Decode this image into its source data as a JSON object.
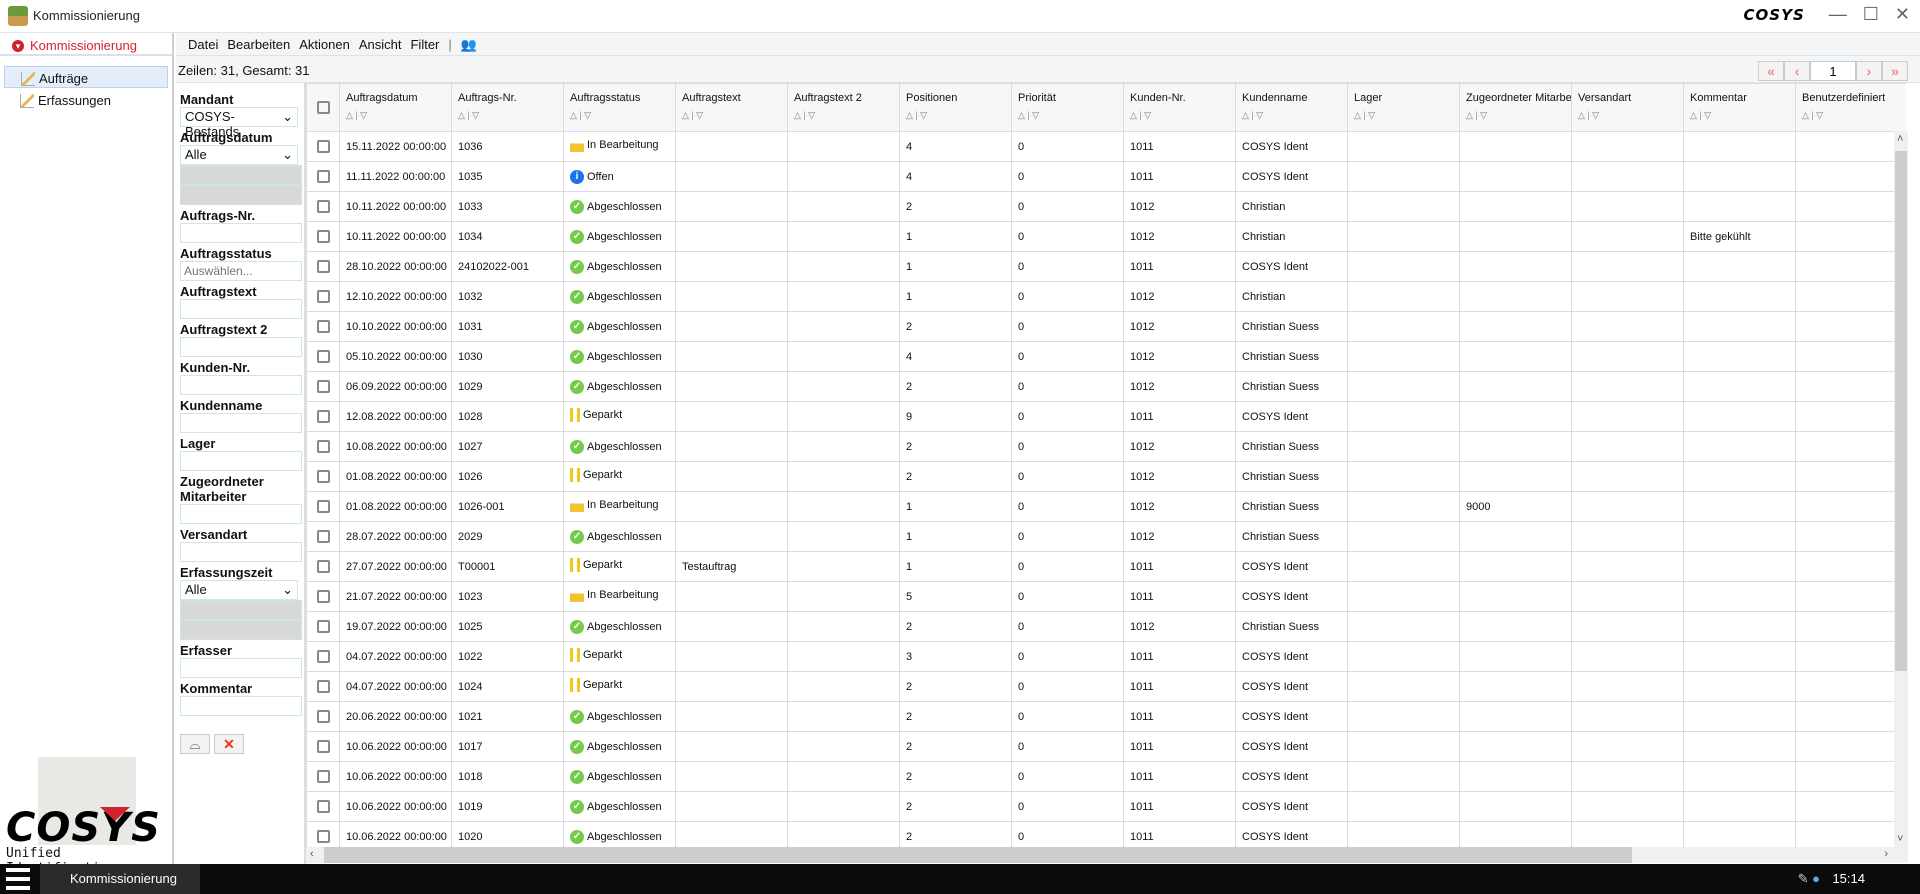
{
  "window": {
    "title": "Kommissionierung",
    "brand": "COSYS",
    "minimize": "—",
    "maximize": "☐",
    "close": "✕"
  },
  "sidebar": {
    "module": "Kommissionierung",
    "items": [
      {
        "label": "Aufträge",
        "selected": true
      },
      {
        "label": "Erfassungen",
        "selected": false
      }
    ],
    "logo_word": "COSYS",
    "logo_sub": "Unified Identification"
  },
  "toolbar": {
    "menus": [
      "Datei",
      "Bearbeiten",
      "Aktionen",
      "Ansicht",
      "Filter"
    ],
    "separator": "|"
  },
  "count": "Zeilen: 31, Gesamt: 31",
  "pager": {
    "page": "1",
    "first": "«",
    "prev": "‹",
    "next": "›",
    "last": "»"
  },
  "filter": {
    "mandant_label": "Mandant",
    "mandant_value": "COSYS-Bestands",
    "auftragsdatum_label": "Auftragsdatum",
    "auftragsdatum_value": "Alle",
    "auftragsnr_label": "Auftrags-Nr.",
    "auftragsstatus_label": "Auftragsstatus",
    "auftragsstatus_placeholder": "Auswählen...",
    "auftragstext_label": "Auftragstext",
    "auftragstext2_label": "Auftragstext 2",
    "kundennr_label": "Kunden-Nr.",
    "kundenname_label": "Kundenname",
    "lager_label": "Lager",
    "mitarbeiter_label1": "Zugeordneter",
    "mitarbeiter_label2": "Mitarbeiter",
    "versandart_label": "Versandart",
    "erfassungszeit_label": "Erfassungszeit",
    "erfassungszeit_value": "Alle",
    "erfasser_label": "Erfasser",
    "kommentar_label": "Kommentar"
  },
  "columns": [
    "Auftragsdatum",
    "Auftrags-Nr.",
    "Auftragsstatus",
    "Auftragstext",
    "Auftragstext 2",
    "Positionen",
    "Priorität",
    "Kunden-Nr.",
    "Kundenname",
    "Lager",
    "Zugeordneter Mitarbeiter",
    "Versandart",
    "Kommentar",
    "Benutzerdefiniert"
  ],
  "status_colors": {
    "Abgeschlossen": "#74cb4a",
    "Offen": "#1a73e8",
    "Geparkt": "#f4c71a",
    "In Bearbeitung": "#f2c230"
  },
  "rows": [
    [
      "15.11.2022 00:00:00",
      "1036",
      "In Bearbeitung",
      "",
      "",
      "4",
      "0",
      "1011",
      "COSYS Ident",
      "",
      "",
      "",
      "",
      ""
    ],
    [
      "11.11.2022 00:00:00",
      "1035",
      "Offen",
      "",
      "",
      "4",
      "0",
      "1011",
      "COSYS Ident",
      "",
      "",
      "",
      "",
      ""
    ],
    [
      "10.11.2022 00:00:00",
      "1033",
      "Abgeschlossen",
      "",
      "",
      "2",
      "0",
      "1012",
      "Christian",
      "",
      "",
      "",
      "",
      ""
    ],
    [
      "10.11.2022 00:00:00",
      "1034",
      "Abgeschlossen",
      "",
      "",
      "1",
      "0",
      "1012",
      "Christian",
      "",
      "",
      "",
      "Bitte gekühlt",
      ""
    ],
    [
      "28.10.2022 00:00:00",
      "24102022-001",
      "Abgeschlossen",
      "",
      "",
      "1",
      "0",
      "1011",
      "COSYS Ident",
      "",
      "",
      "",
      "",
      ""
    ],
    [
      "12.10.2022 00:00:00",
      "1032",
      "Abgeschlossen",
      "",
      "",
      "1",
      "0",
      "1012",
      "Christian",
      "",
      "",
      "",
      "",
      ""
    ],
    [
      "10.10.2022 00:00:00",
      "1031",
      "Abgeschlossen",
      "",
      "",
      "2",
      "0",
      "1012",
      "Christian Suess",
      "",
      "",
      "",
      "",
      ""
    ],
    [
      "05.10.2022 00:00:00",
      "1030",
      "Abgeschlossen",
      "",
      "",
      "4",
      "0",
      "1012",
      "Christian Suess",
      "",
      "",
      "",
      "",
      ""
    ],
    [
      "06.09.2022 00:00:00",
      "1029",
      "Abgeschlossen",
      "",
      "",
      "2",
      "0",
      "1012",
      "Christian Suess",
      "",
      "",
      "",
      "",
      ""
    ],
    [
      "12.08.2022 00:00:00",
      "1028",
      "Geparkt",
      "",
      "",
      "9",
      "0",
      "1011",
      "COSYS Ident",
      "",
      "",
      "",
      "",
      ""
    ],
    [
      "10.08.2022 00:00:00",
      "1027",
      "Abgeschlossen",
      "",
      "",
      "2",
      "0",
      "1012",
      "Christian Suess",
      "",
      "",
      "",
      "",
      ""
    ],
    [
      "01.08.2022 00:00:00",
      "1026",
      "Geparkt",
      "",
      "",
      "2",
      "0",
      "1012",
      "Christian Suess",
      "",
      "",
      "",
      "",
      ""
    ],
    [
      "01.08.2022 00:00:00",
      "1026-001",
      "In Bearbeitung",
      "",
      "",
      "1",
      "0",
      "1012",
      "Christian Suess",
      "",
      "9000",
      "",
      "",
      ""
    ],
    [
      "28.07.2022 00:00:00",
      "2029",
      "Abgeschlossen",
      "",
      "",
      "1",
      "0",
      "1012",
      "Christian Suess",
      "",
      "",
      "",
      "",
      ""
    ],
    [
      "27.07.2022 00:00:00",
      "T00001",
      "Geparkt",
      "Testauftrag",
      "",
      "1",
      "0",
      "1011",
      "COSYS Ident",
      "",
      "",
      "",
      "",
      ""
    ],
    [
      "21.07.2022 00:00:00",
      "1023",
      "In Bearbeitung",
      "",
      "",
      "5",
      "0",
      "1011",
      "COSYS Ident",
      "",
      "",
      "",
      "",
      ""
    ],
    [
      "19.07.2022 00:00:00",
      "1025",
      "Abgeschlossen",
      "",
      "",
      "2",
      "0",
      "1012",
      "Christian Suess",
      "",
      "",
      "",
      "",
      ""
    ],
    [
      "04.07.2022 00:00:00",
      "1022",
      "Geparkt",
      "",
      "",
      "3",
      "0",
      "1011",
      "COSYS Ident",
      "",
      "",
      "",
      "",
      ""
    ],
    [
      "04.07.2022 00:00:00",
      "1024",
      "Geparkt",
      "",
      "",
      "2",
      "0",
      "1011",
      "COSYS Ident",
      "",
      "",
      "",
      "",
      ""
    ],
    [
      "20.06.2022 00:00:00",
      "1021",
      "Abgeschlossen",
      "",
      "",
      "2",
      "0",
      "1011",
      "COSYS Ident",
      "",
      "",
      "",
      "",
      ""
    ],
    [
      "10.06.2022 00:00:00",
      "1017",
      "Abgeschlossen",
      "",
      "",
      "2",
      "0",
      "1011",
      "COSYS Ident",
      "",
      "",
      "",
      "",
      ""
    ],
    [
      "10.06.2022 00:00:00",
      "1018",
      "Abgeschlossen",
      "",
      "",
      "2",
      "0",
      "1011",
      "COSYS Ident",
      "",
      "",
      "",
      "",
      ""
    ],
    [
      "10.06.2022 00:00:00",
      "1019",
      "Abgeschlossen",
      "",
      "",
      "2",
      "0",
      "1011",
      "COSYS Ident",
      "",
      "",
      "",
      "",
      ""
    ],
    [
      "10.06.2022 00:00:00",
      "1020",
      "Abgeschlossen",
      "",
      "",
      "2",
      "0",
      "1011",
      "COSYS Ident",
      "",
      "",
      "",
      "",
      ""
    ]
  ],
  "taskbar": {
    "task": "Kommissionierung",
    "clock": "15:14"
  }
}
